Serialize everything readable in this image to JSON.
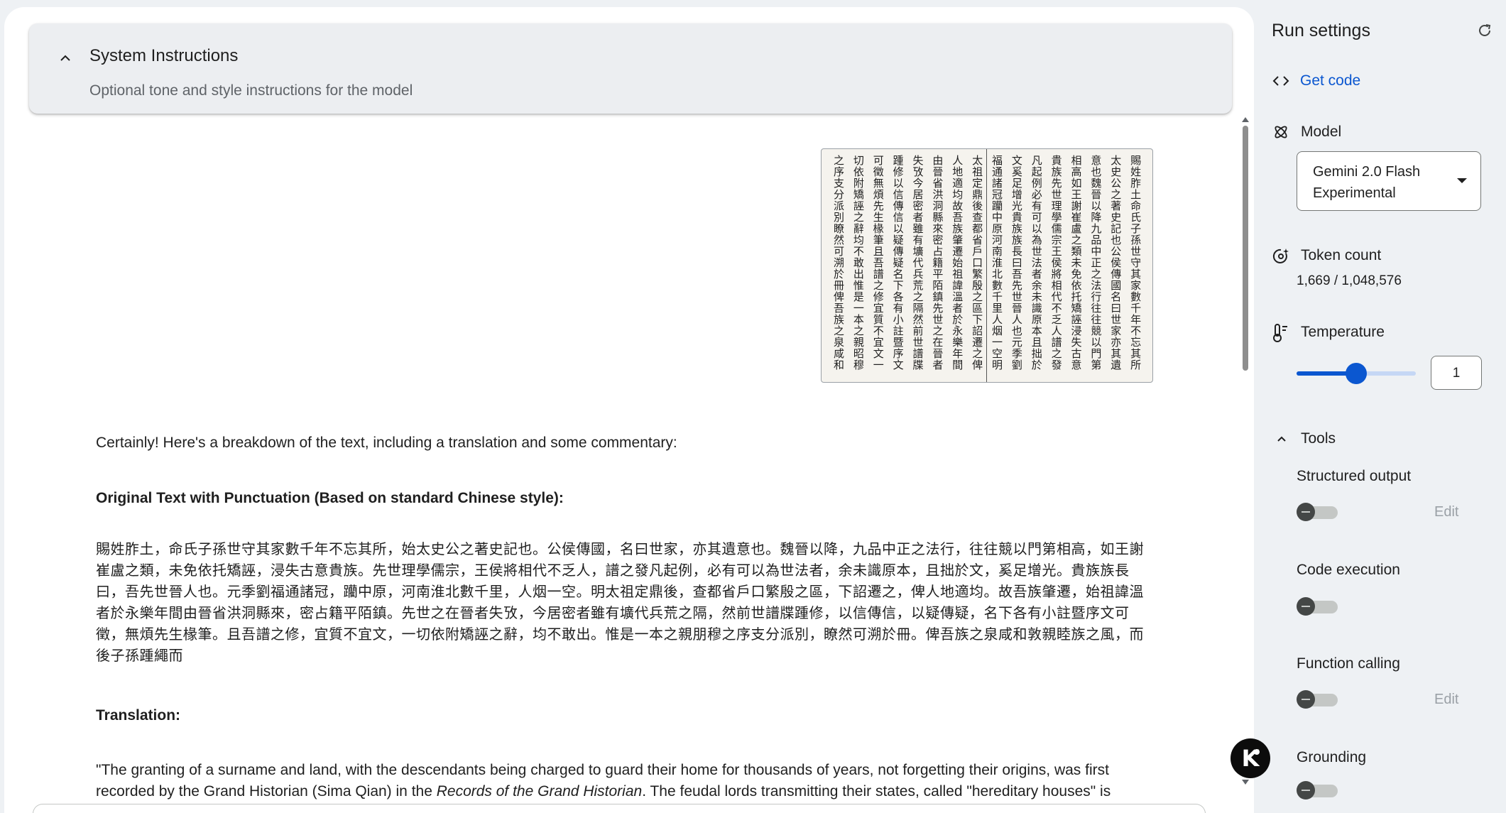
{
  "system_instructions": {
    "title": "System Instructions",
    "placeholder": "Optional tone and style instructions for the model"
  },
  "chat": {
    "image_text_columns": [
      "賜姓胙土命氏子孫世守其家數千年不忘其所始",
      "太史公之著史記也公侯傳國名曰世家亦其遺",
      "意也魏晉以降九品中正之法行往往競以門第",
      "相高如王謝崔盧之類未免依托矯誣浸失古意",
      "貴族先世理學儒宗王侯將相代不乏人譜之發",
      "凡起例必有可以為世法者余未識原本且拙於",
      "文奚足增光貴族族長曰吾先世晉人也元季劉",
      "福通諸冠躪中原河南淮北數千里人烟一空明",
      "太祖定鼎後查都省戶口繁殷之區下詔遷之俾",
      "人地適均故吾族肇遷始祖諱溫者於永樂年間",
      "由晉省洪洞縣來密占籍平陌鎮先世之在晉者",
      "失攷今居密者雖有壙代兵荒之隔然前世譜牒",
      "踵修以信傳信以疑傳疑名下各有小註暨序文",
      "可徵無煩先生椽筆且吾譜之修宜質不宜文一",
      "切依附矯誣之辭均不敢出惟是一本之親昭穆",
      "之序支分派別瞭然可溯於冊俾吾族之泉咸和"
    ],
    "response": {
      "intro": "Certainly! Here's a breakdown of the text, including a translation and some commentary:",
      "heading_original": "Original Text with Punctuation (Based on standard Chinese style):",
      "original_text": "賜姓胙土，命氏子孫世守其家數千年不忘其所，始太史公之著史記也。公侯傳國，名曰世家，亦其遺意也。魏晉以降，九品中正之法行，往往競以門第相高，如王謝崔盧之類，未免依托矯誣，浸失古意貴族。先世理學儒宗，王侯將相代不乏人，譜之發凡起例，必有可以為世法者，余未識原本，且拙於文，奚足增光。貴族族長曰，吾先世晉人也。元季劉福通諸冠，躪中原，河南淮北數千里，人烟一空。明太祖定鼎後，查都省戶口繁殷之區，下詔遷之，俾人地適均。故吾族肇遷，始祖諱溫者於永樂年間由晉省洪洞縣來，密占籍平陌鎮。先世之在晉者失攷，今居密者雖有壙代兵荒之隔，然前世譜牒踵修，以信傳信，以疑傳疑，名下各有小註暨序文可徵，無煩先生椽筆。且吾譜之修，宜質不宜文，一切依附矯誣之辭，均不敢出。惟是一本之親朋穆之序支分派別，瞭然可溯於冊。俾吾族之泉咸和敦親睦族之風，而後子孫踵繩而",
      "heading_translation": "Translation:",
      "translation_part1": "\"The granting of a surname and land, with the descendants being charged to guard their home for thousands of years, not forgetting their origins, was first recorded by the Grand Historian (Sima Qian) in the ",
      "translation_italic": "Records of the Grand Historian",
      "translation_part2": ". The feudal lords transmitting their states, called \"hereditary houses\" is"
    }
  },
  "sidebar": {
    "title": "Run settings",
    "get_code": "Get code",
    "model": {
      "label": "Model",
      "value": "Gemini 2.0 Flash Experimental"
    },
    "token_count": {
      "label": "Token count",
      "value": "1,669 / 1,048,576"
    },
    "temperature": {
      "label": "Temperature",
      "value": "1",
      "min": 0,
      "max": 2,
      "fraction": 0.5
    },
    "tools": {
      "label": "Tools",
      "items": [
        {
          "label": "Structured output",
          "enabled": false,
          "edit": "Edit"
        },
        {
          "label": "Code execution",
          "enabled": false,
          "edit": ""
        },
        {
          "label": "Function calling",
          "enabled": false,
          "edit": "Edit"
        },
        {
          "label": "Grounding",
          "enabled": false,
          "edit": ""
        }
      ]
    }
  },
  "icons": {
    "collapse": "chevron-up-icon",
    "reset": "refresh-icon",
    "code": "code-icon",
    "model": "model-icon",
    "token": "token-count-icon",
    "temperature": "thermometer-icon",
    "assistant": "assistant-fab-icon"
  },
  "colors": {
    "accent": "#0b57d0",
    "slider_track": "#c5d7f5",
    "text": "#1f1f1f",
    "muted": "#5f6368"
  }
}
